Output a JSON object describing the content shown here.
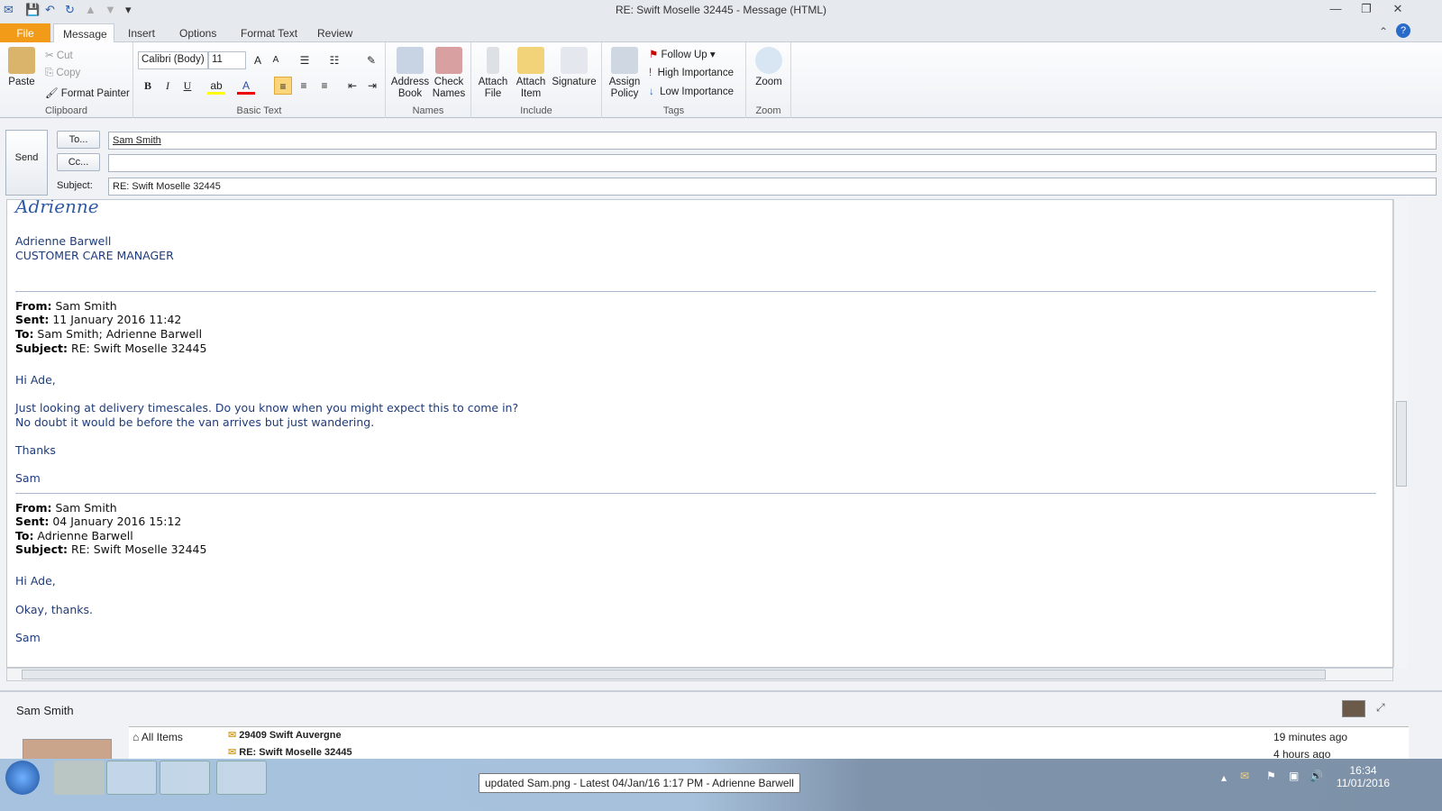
{
  "window": {
    "title": "RE: Swift Moselle 32445  -  Message (HTML)"
  },
  "tabs": [
    {
      "label": "File"
    },
    {
      "label": "Message"
    },
    {
      "label": "Insert"
    },
    {
      "label": "Options"
    },
    {
      "label": "Format Text"
    },
    {
      "label": "Review"
    }
  ],
  "ribbon": {
    "clipboard": {
      "label": "Clipboard",
      "paste": "Paste",
      "cut": "Cut",
      "copy": "Copy",
      "format_painter": "Format Painter"
    },
    "basic_text": {
      "label": "Basic Text",
      "font": "Calibri (Body)",
      "size": "11",
      "bold": "B",
      "italic": "I",
      "underline": "U"
    },
    "names": {
      "label": "Names",
      "address_book": "Address Book",
      "check_names": "Check Names"
    },
    "include": {
      "label": "Include",
      "attach_file": "Attach File",
      "attach_item": "Attach Item",
      "signature": "Signature"
    },
    "tags": {
      "label": "Tags",
      "assign_policy": "Assign Policy",
      "follow_up": "Follow Up",
      "high": "High Importance",
      "low": "Low Importance"
    },
    "zoom": {
      "label": "Zoom",
      "zoom": "Zoom"
    }
  },
  "header": {
    "send": "Send",
    "to_btn": "To...",
    "cc_btn": "Cc...",
    "subject_label": "Subject:",
    "to": "Sam Smith",
    "cc": "",
    "subject": "RE: Swift Moselle 32445"
  },
  "body": {
    "signature_script": "Adrienne",
    "sig_name": "Adrienne Barwell",
    "sig_title": "CUSTOMER CARE MANAGER",
    "msg1": {
      "from_l": "From:",
      "from": " Sam Smith",
      "sent_l": "Sent:",
      "sent": " 11 January 2016 11:42",
      "to_l": "To:",
      "to": " Sam Smith; Adrienne Barwell",
      "subj_l": "Subject:",
      "subj": " RE: Swift Moselle 32445",
      "lines": [
        "Hi Ade,",
        "Just looking at delivery timescales. Do you know when you might expect this to come in?",
        "No doubt it would be before the van arrives but just wandering.",
        "Thanks",
        "Sam"
      ]
    },
    "msg2": {
      "from_l": "From:",
      "from": " Sam Smith",
      "sent_l": "Sent:",
      "sent": " 04 January 2016 15:12",
      "to_l": "To:",
      "to": " Adrienne Barwell",
      "subj_l": "Subject:",
      "subj": " RE: Swift Moselle 32445",
      "lines": [
        "Hi Ade,",
        "Okay, thanks.",
        "Sam"
      ]
    }
  },
  "people_pane": {
    "name": "Sam Smith",
    "all_items": "All Items",
    "items": [
      {
        "subject": "29409 Swift Auvergne",
        "time": "19 minutes ago"
      },
      {
        "subject": "RE: Swift Moselle 32445",
        "time": "4 hours ago"
      }
    ]
  },
  "taskbar": {
    "tooltip": "updated Sam.png - Latest 04/Jan/16 1:17 PM - Adrienne Barwell",
    "time": "16:34",
    "date": "11/01/2016"
  }
}
